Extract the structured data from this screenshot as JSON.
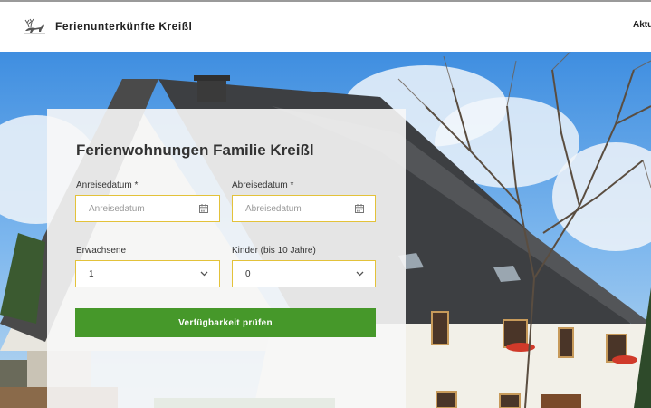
{
  "header": {
    "brand": "Ferienunterkünfte Kreißl",
    "nav_item": "Aktu",
    "logo_icon": "deer-icon"
  },
  "booking": {
    "title": "Ferienwohnungen Familie Kreißl",
    "arrival": {
      "label": "Anreisedatum",
      "required_mark": "*",
      "placeholder": "Anreisedatum",
      "icon": "calendar-icon"
    },
    "departure": {
      "label": "Abreisedatum",
      "required_mark": "*",
      "placeholder": "Abreisedatum",
      "icon": "calendar-icon"
    },
    "adults": {
      "label": "Erwachsene",
      "value": "1",
      "icon": "chevron-down-icon"
    },
    "children": {
      "label": "Kinder (bis 10 Jahre)",
      "value": "0",
      "icon": "chevron-down-icon"
    },
    "submit_label": "Verfügbarkeit prüfen"
  },
  "colors": {
    "accent_border": "#e3c23a",
    "button_green": "#46982a"
  }
}
